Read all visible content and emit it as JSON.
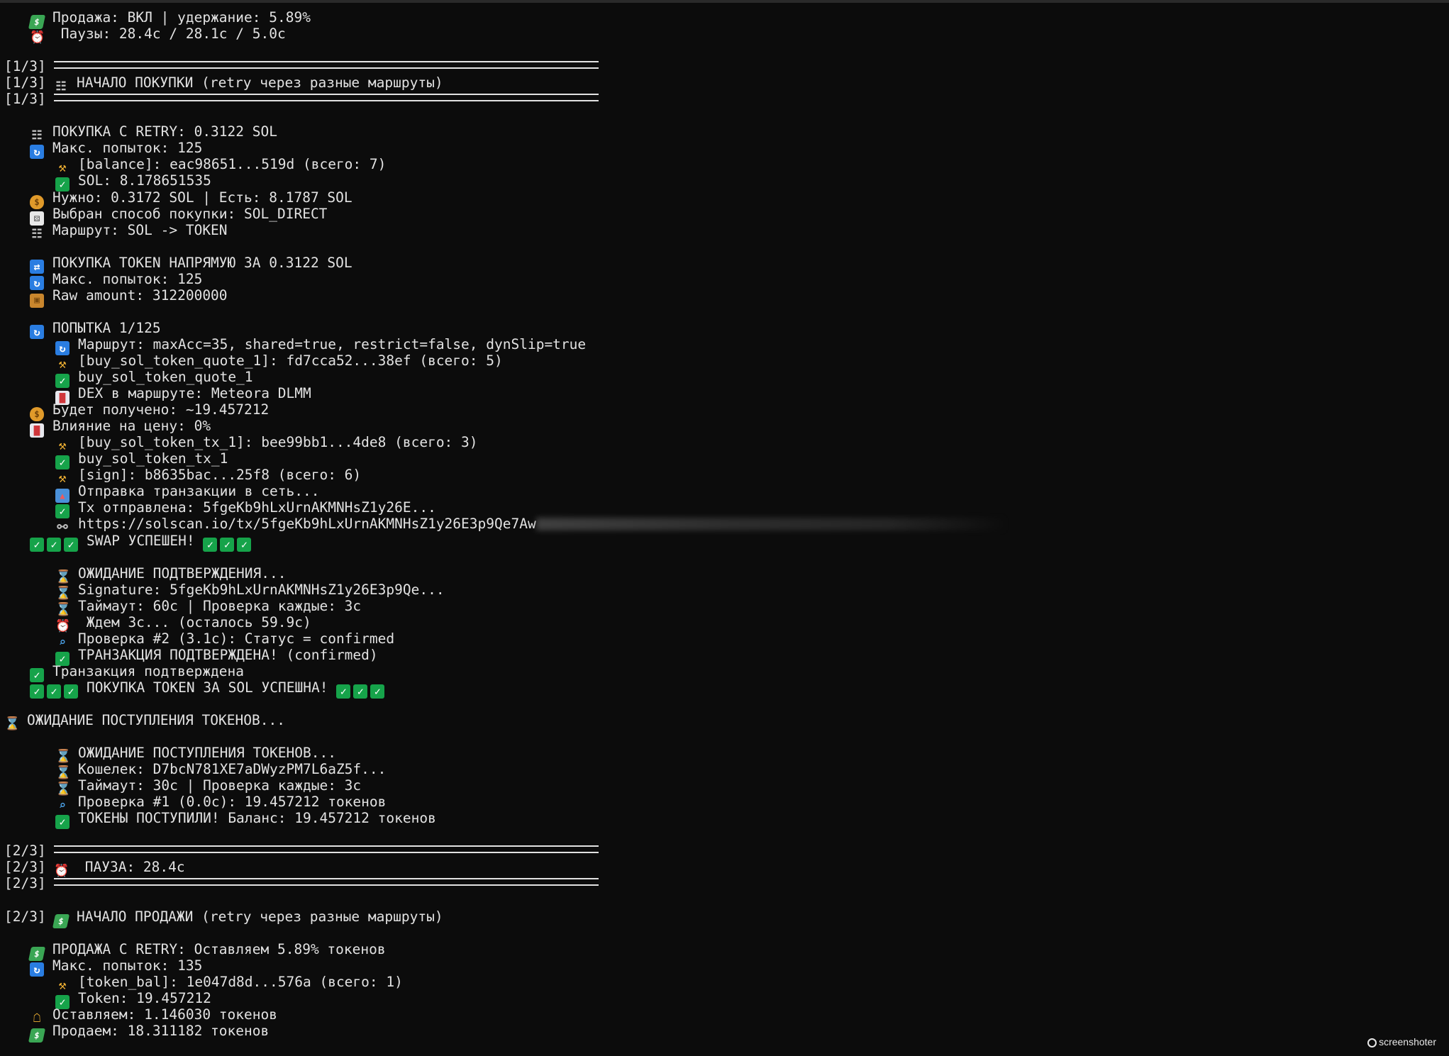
{
  "terminal": {
    "lines": [
      {
        "indent": 1,
        "icon": "flying-money-icon",
        "text": "Продажа: ВКЛ | удержание: 5.89%"
      },
      {
        "indent": 1,
        "icon": "alarm-clock-icon",
        "text": " Паузы: 28.4с / 28.1с / 5.0с"
      },
      {
        "blank": true
      },
      {
        "prefix": "[1/3]",
        "rule": true
      },
      {
        "prefix": "[1/3]",
        "icon": "cart-icon",
        "text": "НАЧАЛО ПОКУПКИ (retry через разные маршруты)"
      },
      {
        "prefix": "[1/3]",
        "rule": true
      },
      {
        "blank": true
      },
      {
        "indent": 1,
        "icon": "cart-icon",
        "text": "ПОКУПКА С RETRY: 0.3122 SOL"
      },
      {
        "indent": 1,
        "icon": "refresh-icon",
        "text": "Макс. попыток: 125"
      },
      {
        "indent": 2,
        "icon": "key-icon",
        "text": "[balance]: eac98651...519d (всего: 7)"
      },
      {
        "indent": 2,
        "icon": "check-icon",
        "text": "SOL: 8.178651535"
      },
      {
        "indent": 1,
        "icon": "money-bag-icon",
        "text": "Нужно: 0.3172 SOL | Есть: 8.1787 SOL"
      },
      {
        "indent": 1,
        "icon": "dice-icon",
        "text": "Выбран способ покупки: SOL_DIRECT"
      },
      {
        "indent": 1,
        "icon": "cart-icon",
        "text": "Маршрут: SOL -> TOKEN"
      },
      {
        "blank": true
      },
      {
        "indent": 1,
        "icon": "swap-icon",
        "text": "ПОКУПКА TOKEN НАПРЯМУЮ ЗА 0.3122 SOL"
      },
      {
        "indent": 1,
        "icon": "refresh-icon",
        "text": "Макс. попыток: 125"
      },
      {
        "indent": 1,
        "icon": "package-icon",
        "text": "Raw amount: 312200000"
      },
      {
        "blank": true
      },
      {
        "indent": 1,
        "icon": "refresh-icon",
        "text": "ПОПЫТКА 1/125"
      },
      {
        "indent": 2,
        "icon": "refresh-icon",
        "text": "Маршрут: maxAcc=35, shared=true, restrict=false, dynSlip=true"
      },
      {
        "indent": 2,
        "icon": "key-icon",
        "text": "[buy_sol_token_quote_1]: fd7cca52...38ef (всего: 5)"
      },
      {
        "indent": 2,
        "icon": "check-icon",
        "text": "buy_sol_token_quote_1"
      },
      {
        "indent": 2,
        "icon": "chart-icon",
        "text": "DEX в маршруте: Meteora DLMM"
      },
      {
        "indent": 1,
        "icon": "money-bag-icon",
        "text": "Будет получено: ~19.457212"
      },
      {
        "indent": 1,
        "icon": "chart-icon",
        "text": "Влияние на цену: 0%"
      },
      {
        "indent": 2,
        "icon": "key-icon",
        "text": "[buy_sol_token_tx_1]: bee99bb1...4de8 (всего: 3)"
      },
      {
        "indent": 2,
        "icon": "check-icon",
        "text": "buy_sol_token_tx_1"
      },
      {
        "indent": 2,
        "icon": "key-icon",
        "text": "[sign]: b8635bac...25f8 (всего: 6)"
      },
      {
        "indent": 2,
        "icon": "outbox-icon",
        "text": "Отправка транзакции в сеть..."
      },
      {
        "indent": 2,
        "icon": "check-icon",
        "text": "Tx отправлена: 5fgeKb9hLxUrnAKMNHsZ1y26E..."
      },
      {
        "indent": 2,
        "icon": "link-icon",
        "text": "https://solscan.io/tx/5fgeKb9hLxUrnAKMNHsZ1y26E3p9Qe7Aw",
        "blurred_tail": true
      },
      {
        "indent": 1,
        "triple_check": true,
        "text": "SWAP УСПЕШЕН!"
      },
      {
        "blank": true
      },
      {
        "indent": 2,
        "icon": "hourglass-icon",
        "text": "ОЖИДАНИЕ ПОДТВЕРЖДЕНИЯ..."
      },
      {
        "indent": 2,
        "icon": "hourglass-icon",
        "text": "Signature: 5fgeKb9hLxUrnAKMNHsZ1y26E3p9Qe..."
      },
      {
        "indent": 2,
        "icon": "hourglass-icon",
        "text": "Таймаут: 60с | Проверка каждые: 3с"
      },
      {
        "indent": 2,
        "icon": "alarm-clock-icon",
        "text": " Ждем 3с... (осталось 59.9с)"
      },
      {
        "indent": 2,
        "icon": "magnifier-icon",
        "text": "Проверка #2 (3.1с): Статус = confirmed"
      },
      {
        "indent": 2,
        "icon": "check-icon",
        "text": "ТРАНЗАКЦИЯ ПОДТВЕРЖДЕНА! (confirmed)"
      },
      {
        "indent": 1,
        "icon": "check-icon",
        "text": "Транзакция подтверждена"
      },
      {
        "indent": 1,
        "triple_check": true,
        "text": "ПОКУПКА TOKEN ЗА SOL УСПЕШНА!"
      },
      {
        "blank": true
      },
      {
        "indent": 0,
        "icon": "hourglass-icon",
        "text": "ОЖИДАНИЕ ПОСТУПЛЕНИЯ ТОКЕНОВ..."
      },
      {
        "blank": true
      },
      {
        "indent": 2,
        "icon": "hourglass-icon",
        "text": "ОЖИДАНИЕ ПОСТУПЛЕНИЯ ТОКЕНОВ..."
      },
      {
        "indent": 2,
        "icon": "hourglass-icon",
        "text": "Кошелек: D7bcN781XE7aDWyzPM7L6aZ5f..."
      },
      {
        "indent": 2,
        "icon": "hourglass-icon",
        "text": "Таймаут: 30с | Проверка каждые: 3с"
      },
      {
        "indent": 2,
        "icon": "magnifier-icon",
        "text": "Проверка #1 (0.0с): 19.457212 токенов"
      },
      {
        "indent": 2,
        "icon": "check-icon",
        "text": "ТОКЕНЫ ПОСТУПИЛИ! Баланс: 19.457212 токенов"
      },
      {
        "blank": true
      },
      {
        "prefix": "[2/3]",
        "rule": true
      },
      {
        "prefix": "[2/3]",
        "icon": "alarm-clock-icon",
        "text": " ПАУЗА: 28.4с"
      },
      {
        "prefix": "[2/3]",
        "rule": true
      },
      {
        "blank": true
      },
      {
        "prefix": "[2/3]",
        "icon": "flying-money-icon",
        "text": "НАЧАЛО ПРОДАЖИ (retry через разные маршруты)"
      },
      {
        "blank": true
      },
      {
        "indent": 1,
        "icon": "flying-money-icon",
        "text": "ПРОДАЖА С RETRY: Оставляем 5.89% токенов"
      },
      {
        "indent": 1,
        "icon": "refresh-icon",
        "text": "Макс. попыток: 135"
      },
      {
        "indent": 2,
        "icon": "key-icon",
        "text": "[token_bal]: 1e047d8d...576a (всего: 1)"
      },
      {
        "indent": 2,
        "icon": "check-icon",
        "text": "Token: 19.457212"
      },
      {
        "indent": 1,
        "icon": "lock-icon",
        "text": "Оставляем: 1.146030 токенов"
      },
      {
        "indent": 1,
        "icon": "flying-money-icon",
        "text": "Продаем: 18.311182 токенов"
      }
    ]
  },
  "watermark": {
    "text": "screenshoter"
  },
  "colors": {
    "background": "#0c0c0c",
    "text": "#e2e2e2",
    "check": "#16a34a",
    "info_blue": "#2a7de1"
  }
}
